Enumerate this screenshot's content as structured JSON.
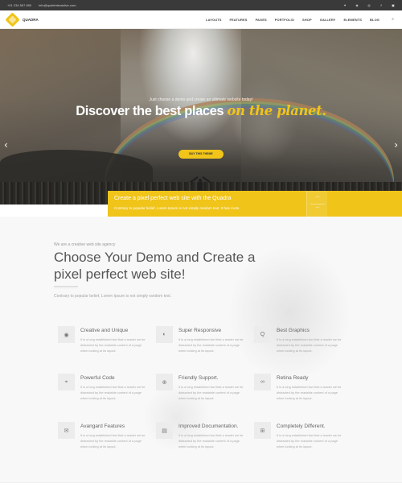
{
  "topbar": {
    "phone": "+01 234 567 890",
    "email": "info@qodeinteractive.com",
    "social_icons": [
      "twitter-icon",
      "pinterest-icon",
      "instagram-icon",
      "facebook-icon",
      "instagram-icon"
    ]
  },
  "header": {
    "logo_text": "QUADRA",
    "nav": [
      "LAYOUTS",
      "FEATURES",
      "PAGES",
      "PORTFOLIO",
      "SHOP",
      "GALLERY",
      "ELEMENTS",
      "BLOG"
    ]
  },
  "hero": {
    "subtitle": "Just choose a demo and create an ultimate website today!",
    "title_main": "Discover the best places",
    "title_accent": "on the planet.",
    "button_label": "BUY THIS THEME",
    "prev_arrow": "‹",
    "next_arrow": "›"
  },
  "promo": {
    "title": "Create a pixel perfect web site with the Quadra",
    "text": "Contrary to popular belief, Lorem Ipsum is not simply random text. It has roots.",
    "up": "︿",
    "down": "﹀"
  },
  "section": {
    "eyebrow": "We are a creative web site agency",
    "headline": "Choose Your Demo and Create a pixel perfect web site!",
    "lead": "Contrary to popular belief, Lorem Ipsum is not simply random text."
  },
  "features": [
    {
      "title": "Creative and Unique",
      "icon": "target-icon",
      "glyph": "◉",
      "desc": "It is a long established fact that a reader we be distracted by the readable content of a page when looking at its layout."
    },
    {
      "title": "Super Responsive",
      "icon": "compass-icon",
      "glyph": "◐",
      "desc": "It is a long established fact that a reader we be distracted by the readable content of a page when looking at its layout."
    },
    {
      "title": "Best Graphics",
      "icon": "search-icon",
      "glyph": "Q",
      "desc": "It is a long established fact that a reader we be distracted by the readable content of a page when looking at its layout."
    },
    {
      "title": "Powerful Code",
      "icon": "cursor-icon",
      "glyph": "⌖",
      "desc": "It is a long established fact that a reader we be distracted by the readable content of a page when looking at its layout."
    },
    {
      "title": "Friendly Support.",
      "icon": "lifebuoy-icon",
      "glyph": "⊕",
      "desc": "It is a long established fact that a reader we be distracted by the readable content of a page when looking at its layout."
    },
    {
      "title": "Retina Ready",
      "icon": "glasses-icon",
      "glyph": "∞",
      "desc": "It is a long established fact that a reader we be distracted by the readable content of a page when looking at its layout."
    },
    {
      "title": "Avangard Features",
      "icon": "chat-icon",
      "glyph": "✉",
      "desc": "It is a long established fact that a reader we be distracted by the readable content of a page when looking at its layout."
    },
    {
      "title": "Improved Documentation.",
      "icon": "book-icon",
      "glyph": "▤",
      "desc": "It is a long established fact that a reader we be distracted by the readable content of a page when looking at its layout."
    },
    {
      "title": "Completely Different.",
      "icon": "layout-icon",
      "glyph": "⊞",
      "desc": "It is a long established fact that a reader we be distracted by the readable content of a page when looking at its layout."
    }
  ],
  "colors": {
    "accent": "#f0c419",
    "topbar": "#3a3a3a",
    "section_bg": "#f8f8f8"
  }
}
